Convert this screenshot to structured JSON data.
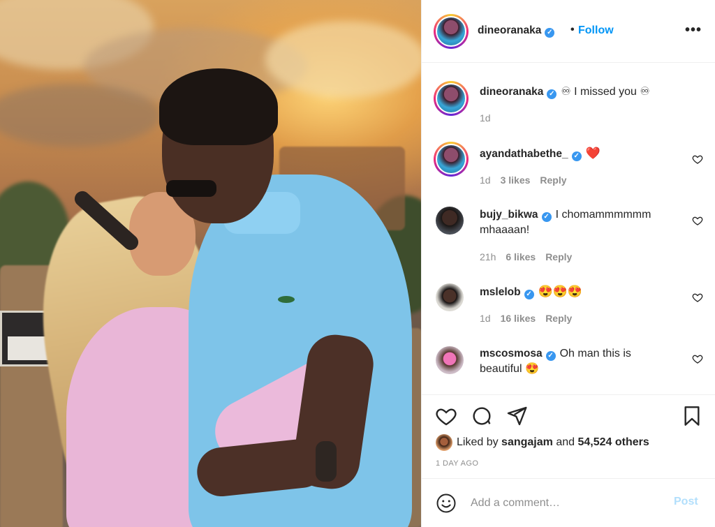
{
  "photo": {
    "alt": "couple kissing at sunset"
  },
  "header": {
    "username": "dineoranaka",
    "separator": "•",
    "follow_label": "Follow",
    "more_label": "•••",
    "verified_icon": "verified-badge-icon"
  },
  "caption": {
    "username": "dineoranaka",
    "text": "♾ I missed you ♾",
    "time": "1d"
  },
  "comments": [
    {
      "username": "ayandathabethe_",
      "text": "❤️",
      "time": "1d",
      "likes": "3 likes",
      "reply": "Reply"
    },
    {
      "username": "bujy_bikwa",
      "text": "I chomammmmmm mhaaaan!",
      "time": "21h",
      "likes": "6 likes",
      "reply": "Reply"
    },
    {
      "username": "mslelob",
      "text": "😍😍😍",
      "time": "1d",
      "likes": "16 likes",
      "reply": "Reply"
    },
    {
      "username": "mscosmosa",
      "text": "Oh man this is beautiful 😍",
      "time": "",
      "likes": "",
      "reply": ""
    }
  ],
  "likes": {
    "prefix": "Liked by",
    "user": "sangajam",
    "and": "and",
    "count": "54,524 others"
  },
  "timestamp": "1 DAY AGO",
  "composer": {
    "placeholder": "Add a comment…",
    "post_label": "Post"
  },
  "colors": {
    "accent": "#0095f6",
    "verified": "#3897f0",
    "post_disabled": "#b2dffc",
    "muted": "#8e8e8e"
  }
}
